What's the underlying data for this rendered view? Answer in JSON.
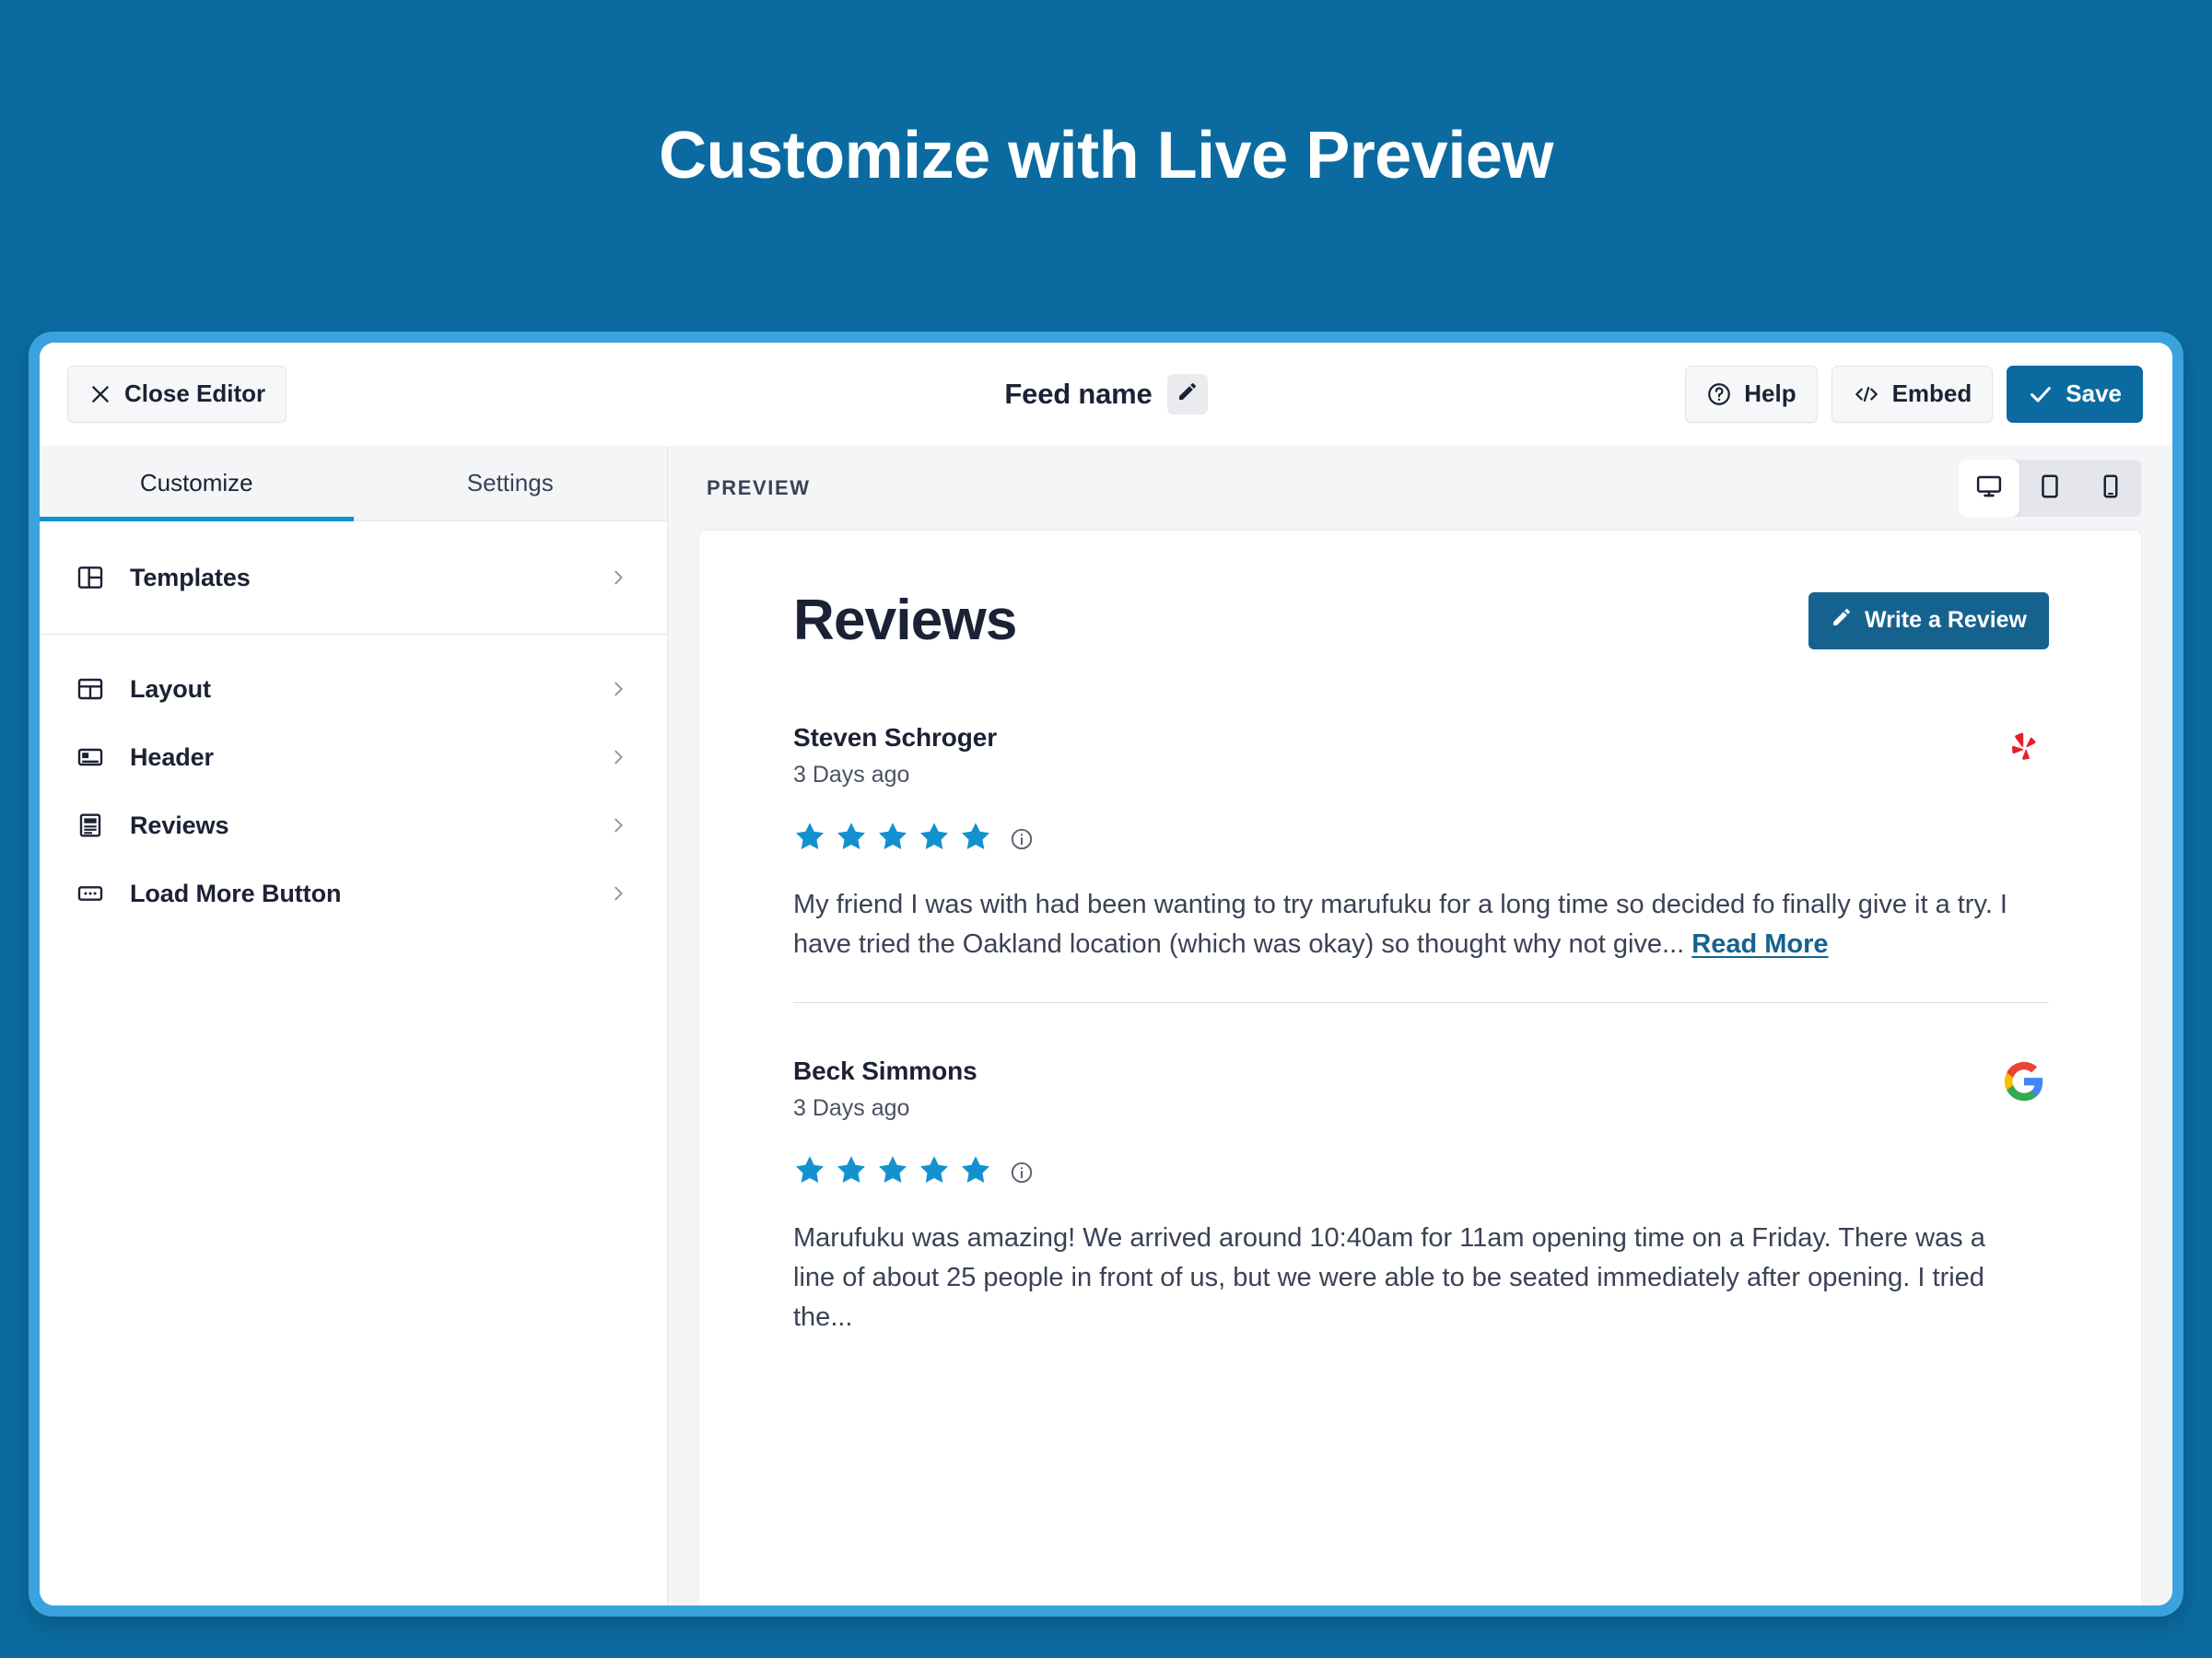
{
  "page": {
    "heading": "Customize with Live Preview",
    "background_color": "#0b6ba0",
    "frame_color": "#3aa3dd"
  },
  "topbar": {
    "close_editor_label": "Close Editor",
    "feed_name": "Feed name",
    "edit_icon": "pencil-icon",
    "help_label": "Help",
    "embed_label": "Embed",
    "save_label": "Save",
    "primary_color": "#0b6ba0"
  },
  "sidebar": {
    "tabs": [
      {
        "label": "Customize",
        "active": true
      },
      {
        "label": "Settings",
        "active": false
      }
    ],
    "active_tab_underline_color": "#1391cf",
    "groups": [
      {
        "items": [
          {
            "label": "Templates",
            "icon": "templates-icon"
          }
        ]
      },
      {
        "items": [
          {
            "label": "Layout",
            "icon": "layout-grid-icon"
          },
          {
            "label": "Header",
            "icon": "header-icon"
          },
          {
            "label": "Reviews",
            "icon": "reviews-document-icon"
          },
          {
            "label": "Load More Button",
            "icon": "load-more-button-icon"
          }
        ]
      }
    ]
  },
  "preview": {
    "label": "PREVIEW",
    "devices": [
      {
        "name": "desktop",
        "active": true
      },
      {
        "name": "tablet",
        "active": false
      },
      {
        "name": "mobile",
        "active": false
      }
    ]
  },
  "feed": {
    "title": "Reviews",
    "write_review_label": "Write a Review",
    "write_review_color": "#16628f",
    "star_color": "#1391cf",
    "reviews": [
      {
        "name": "Steven Schroger",
        "date": "3 Days ago",
        "rating": 5,
        "source": "yelp",
        "text": "My friend I was with had been wanting to try marufuku for a long time so decided fo finally give it a try. I have tried the Oakland location (which was okay) so thought why not give...",
        "read_more_label": "Read More",
        "divided": true
      },
      {
        "name": "Beck Simmons",
        "date": "3 Days ago",
        "rating": 5,
        "source": "google",
        "text": "Marufuku was amazing! We arrived around 10:40am for 11am opening time on a Friday. There was a line of about 25 people in front of us, but we were able to be seated immediately after opening. I tried the...",
        "read_more_label": "",
        "divided": false
      }
    ]
  }
}
